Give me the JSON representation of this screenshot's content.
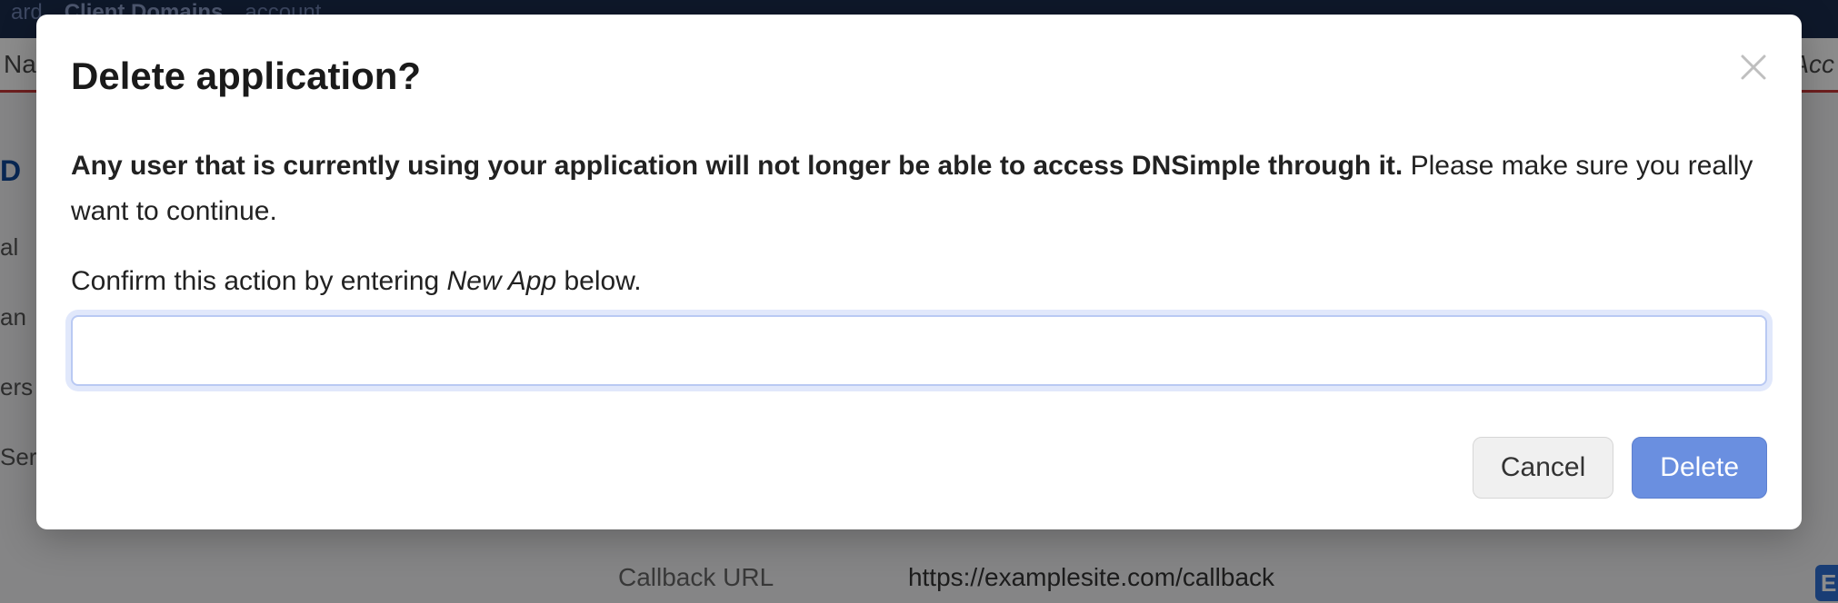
{
  "background": {
    "topbar": {
      "item1": "ard",
      "item2": "Client Domains",
      "item3": "account"
    },
    "subbar": {
      "left": "Na",
      "right": "Acc"
    },
    "side": {
      "heading": "D",
      "item1": "al",
      "item2": "an",
      "item3": "ers",
      "item4": "Server Sets"
    },
    "detail": {
      "label": "Callback URL",
      "value": "https://examplesite.com/callback"
    },
    "edit_button": "E"
  },
  "modal": {
    "title": "Delete application?",
    "warning_bold": "Any user that is currently using your application will not longer be able to access DNSimple through it.",
    "warning_rest": " Please make sure you really want to continue.",
    "confirm_prefix": "Confirm this action by entering ",
    "confirm_app_name": "New App",
    "confirm_suffix": " below.",
    "input_value": "",
    "cancel_label": "Cancel",
    "delete_label": "Delete"
  }
}
